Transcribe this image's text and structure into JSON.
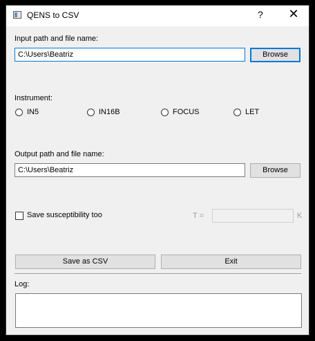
{
  "window": {
    "title": "QENS to CSV",
    "help_label": "?",
    "close_label": "✕"
  },
  "input": {
    "label": "Input path and file name:",
    "value": "C:\\Users\\Beatriz",
    "browse_label": "Browse"
  },
  "instrument": {
    "label": "Instrument:",
    "options": [
      "IN5",
      "IN16B",
      "FOCUS",
      "LET"
    ]
  },
  "output": {
    "label": "Output path and file name:",
    "value": "C:\\Users\\Beatriz",
    "browse_label": "Browse"
  },
  "susceptibility": {
    "label": "Save susceptibility too",
    "checked": false,
    "t_label": "T =",
    "t_value": "",
    "unit": "K"
  },
  "actions": {
    "save_label": "Save as CSV",
    "exit_label": "Exit"
  },
  "log": {
    "label": "Log:",
    "content": ""
  },
  "colors": {
    "background": "#f0f0f0",
    "focus_accent": "#0078d7",
    "button_face": "#e1e1e1"
  }
}
